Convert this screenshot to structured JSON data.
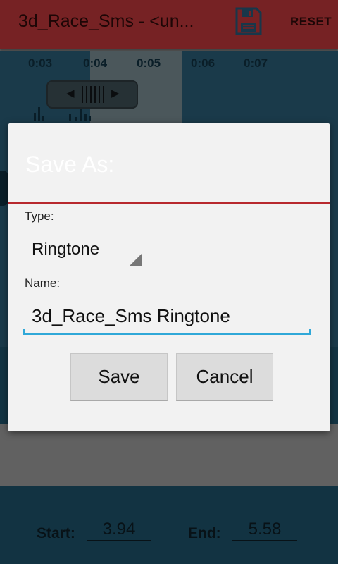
{
  "app": {
    "title": "3d_Race_Sms - <un...",
    "reset_label": "RESET",
    "accent_color": "#a93234"
  },
  "timeline": {
    "ticks": [
      "0:03",
      "0:04",
      "0:05",
      "0:06",
      "0:07"
    ]
  },
  "bottom": {
    "start_label": "Start:",
    "start_value": "3.94",
    "end_label": "End:",
    "end_value": "5.58"
  },
  "dialog": {
    "title": "Save As:",
    "type_label": "Type:",
    "type_value": "Ringtone",
    "name_label": "Name:",
    "name_value": "3d_Race_Sms Ringtone",
    "save_label": "Save",
    "cancel_label": "Cancel"
  },
  "icons": {
    "save": "save-icon",
    "scrub_left": "chevron-left-icon",
    "scrub_right": "chevron-right-icon"
  }
}
